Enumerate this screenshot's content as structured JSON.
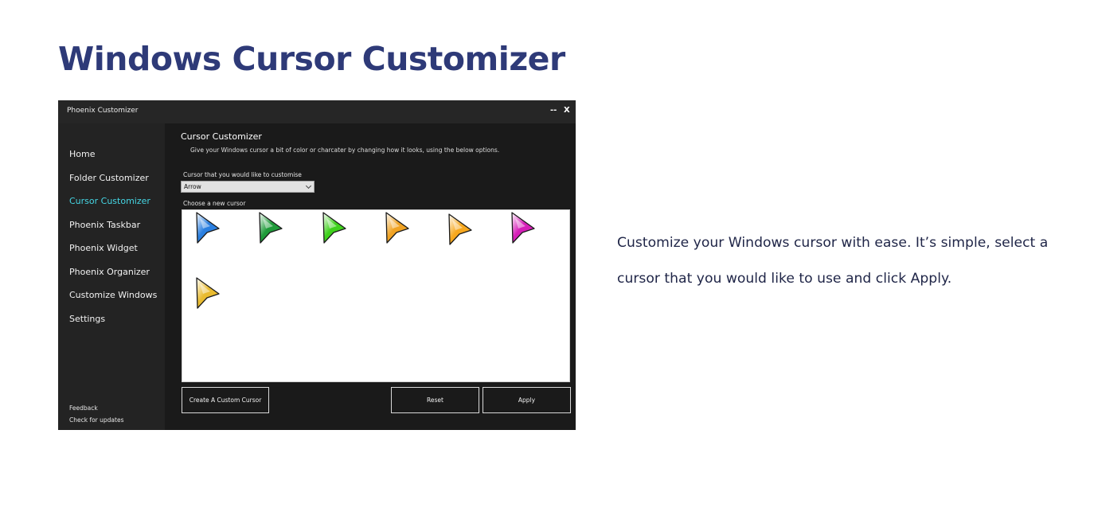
{
  "page": {
    "title": "Windows Cursor Customizer",
    "description": "Customize your Windows cursor with ease. It’s simple, select a cursor that you would like to use and click Apply."
  },
  "window": {
    "title": "Phoenix Customizer",
    "minimize_label": "--",
    "close_label": "X"
  },
  "sidebar": {
    "items": [
      {
        "label": "Home",
        "active": false
      },
      {
        "label": "Folder Customizer",
        "active": false
      },
      {
        "label": "Cursor Customizer",
        "active": true
      },
      {
        "label": "Phoenix Taskbar",
        "active": false
      },
      {
        "label": "Phoenix Widget",
        "active": false
      },
      {
        "label": "Phoenix Organizer",
        "active": false
      },
      {
        "label": "Customize Windows",
        "active": false
      },
      {
        "label": "Settings",
        "active": false
      }
    ],
    "footer": [
      "Feedback",
      "Check for updates"
    ],
    "active_color": "#45d6e4"
  },
  "main": {
    "heading": "Cursor Customizer",
    "description": "Give your Windows cursor a bit of color or charcater by changing how it looks, using the below options.",
    "select_label": "Cursor that you would like to customise",
    "select_value": "Arrow",
    "grid_label": "Choose a new cursor",
    "cursors": [
      {
        "icon": "blue-arrow-cursor-icon",
        "color": "#2a7fe0"
      },
      {
        "icon": "green-arrow-cursor-icon",
        "color": "#1f9b3a"
      },
      {
        "icon": "lime-arrow-cursor-icon",
        "color": "#3fd11c"
      },
      {
        "icon": "orange-arrow-cursor-icon",
        "color": "#f0a324"
      },
      {
        "icon": "amber-arrow-cursor-icon",
        "color": "#f7a81f"
      },
      {
        "icon": "magenta-arrow-cursor-icon",
        "color": "#d61fb8"
      },
      {
        "icon": "gold-arrow-cursor-icon",
        "color": "#e9bb30"
      }
    ],
    "buttons": {
      "custom": "Create A Custom Cursor",
      "reset": "Reset",
      "apply": "Apply"
    }
  }
}
